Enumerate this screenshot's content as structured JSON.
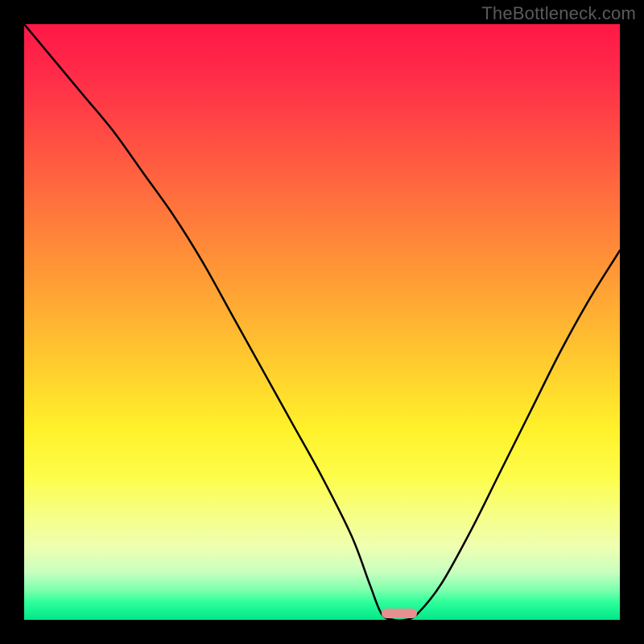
{
  "watermark": "TheBottleneck.com",
  "chart_data": {
    "type": "line",
    "title": "",
    "xlabel": "",
    "ylabel": "",
    "xlim": [
      0,
      100
    ],
    "ylim": [
      0,
      100
    ],
    "grid": false,
    "legend": false,
    "series": [
      {
        "name": "bottleneck-curve",
        "x": [
          0,
          5,
          10,
          15,
          20,
          25,
          30,
          35,
          40,
          45,
          50,
          55,
          58,
          60,
          62,
          64,
          66,
          70,
          75,
          80,
          85,
          90,
          95,
          100
        ],
        "y": [
          100,
          94,
          88,
          82,
          75,
          68,
          60,
          51,
          42,
          33,
          24,
          14,
          6,
          1,
          0,
          0,
          1,
          6,
          15,
          25,
          35,
          45,
          54,
          62
        ]
      }
    ],
    "optimal_marker": {
      "x_start": 60,
      "x_end": 66,
      "y": 0
    },
    "gradient_stops": [
      {
        "pct": 0,
        "color": "#ff1846"
      },
      {
        "pct": 50,
        "color": "#ffcf2e"
      },
      {
        "pct": 80,
        "color": "#fdfd4a"
      },
      {
        "pct": 100,
        "color": "#00e789"
      }
    ]
  }
}
